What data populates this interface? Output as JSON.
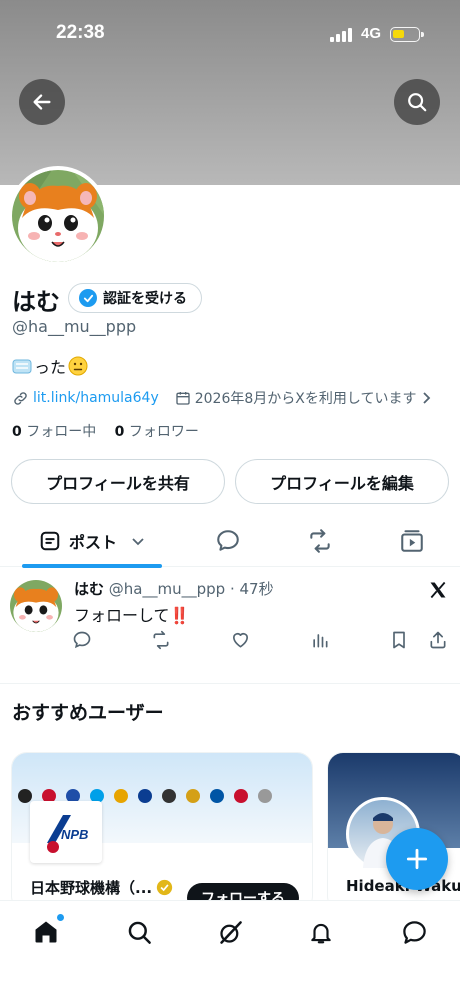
{
  "status_bar": {
    "time": "22:38",
    "network": "4G"
  },
  "profile": {
    "name": "はむ",
    "verify_label": "認証を受ける",
    "handle": "@ha__mu__ppp",
    "bio": "った",
    "link": "lit.link/hamula64y",
    "joined": "2026年8月からXを利用しています",
    "following_count": "0",
    "following_label": " フォロー中",
    "followers_count": "0",
    "followers_label": " フォロワー",
    "share_button": "プロフィールを共有",
    "edit_button": "プロフィールを編集"
  },
  "tabs": {
    "posts_label": "ポスト"
  },
  "post": {
    "author": "はむ",
    "handle_time": "@ha__mu__ppp · 47秒",
    "text": "フォローして‼️"
  },
  "recommended": {
    "title": "おすすめユーザー",
    "cards": [
      {
        "name": "日本野球機構（...",
        "follow_label": "フォローする",
        "logo_text": "NPB"
      },
      {
        "name": "Hideaki Wakui"
      }
    ]
  },
  "colors": {
    "accent": "#1d9bf0",
    "text": "#0f1419",
    "secondary": "#536471"
  }
}
